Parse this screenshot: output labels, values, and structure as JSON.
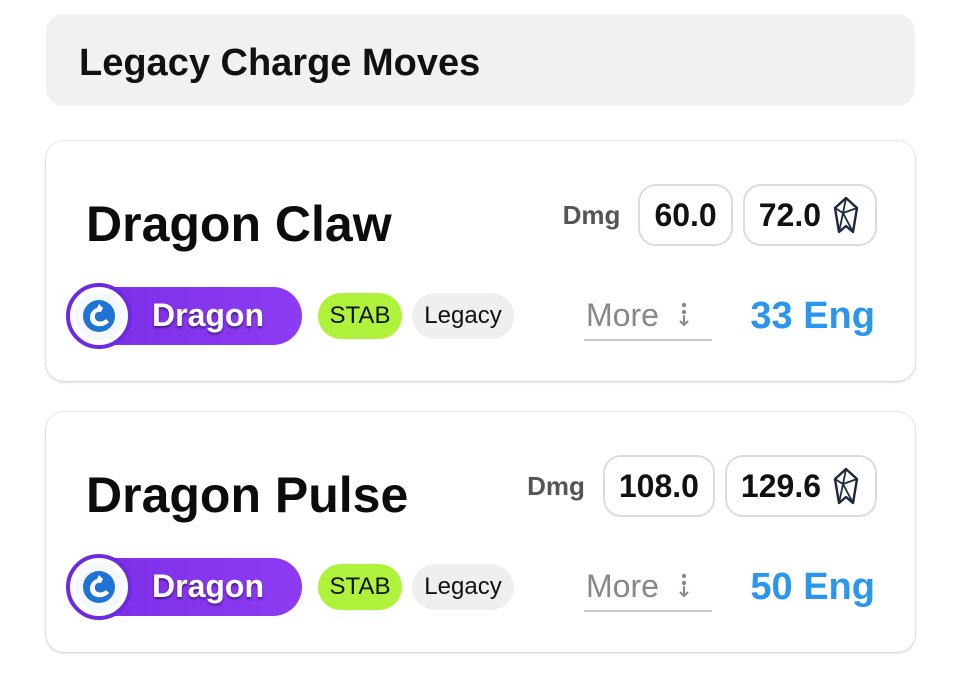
{
  "section": {
    "title": "Legacy Charge Moves"
  },
  "moves": [
    {
      "name": "Dragon Claw",
      "dmg_label": "Dmg",
      "dmg": "60.0",
      "dmg_boosted": "72.0",
      "type": "Dragon",
      "tags": [
        "STAB",
        "Legacy"
      ],
      "more_label": "More",
      "energy": "33 Eng"
    },
    {
      "name": "Dragon Pulse",
      "dmg_label": "Dmg",
      "dmg": "108.0",
      "dmg_boosted": "129.6",
      "type": "Dragon",
      "tags": [
        "STAB",
        "Legacy"
      ],
      "more_label": "More",
      "energy": "50 Eng"
    }
  ],
  "icons": {
    "boosted": "crystal-icon",
    "type": "dragon-type-icon",
    "more": "kebab-icon"
  },
  "colors": {
    "type_pill": "#8438f0",
    "stab_tag": "#aef23b",
    "legacy_tag": "#efefef",
    "energy_text": "#2a96f0"
  }
}
